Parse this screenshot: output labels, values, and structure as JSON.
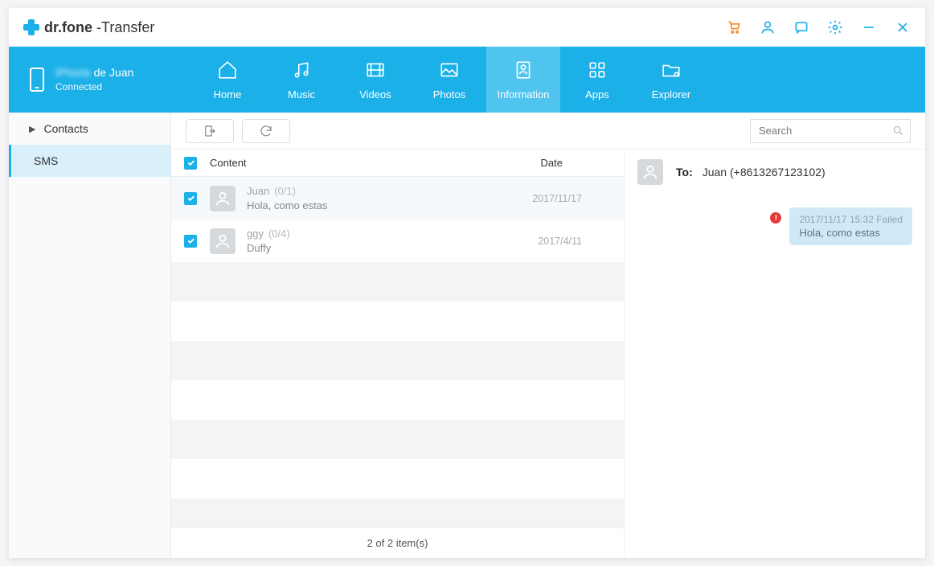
{
  "app": {
    "brand_bold": "dr.fone",
    "brand_suffix": " -Transfer"
  },
  "device": {
    "name_blur": "iPhone",
    "name_suffix": "de Juan",
    "status": "Connected"
  },
  "tabs": [
    "Home",
    "Music",
    "Videos",
    "Photos",
    "Information",
    "Apps",
    "Explorer"
  ],
  "sidebar": {
    "items": [
      "Contacts",
      "SMS"
    ]
  },
  "search": {
    "placeholder": "Search"
  },
  "list": {
    "hdr_content": "Content",
    "hdr_date": "Date",
    "rows": [
      {
        "name": "Juan",
        "count": "(0/1)",
        "preview": "Hola, como estas",
        "date": "2017/11/17"
      },
      {
        "name": "ggy",
        "count": "(0/4)",
        "preview": "Duffy",
        "date": "2017/4/11"
      }
    ],
    "footer": "2  of  2  item(s)"
  },
  "detail": {
    "to_label": "To:",
    "to_value": "Juan (+8613267123102)",
    "msg_meta": "2017/11/17 15:32 Failed",
    "msg_body": "Hola, como estas"
  }
}
